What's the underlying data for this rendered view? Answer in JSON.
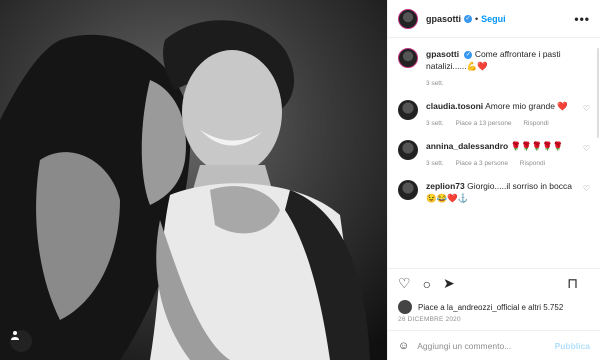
{
  "post": {
    "username": "gpasotti",
    "follow_label": "Segui",
    "dot": "•",
    "more": "•••",
    "caption": "Come affrontare i pasti natalizi......💪❤️",
    "caption_time": "3 sett.",
    "likes_text": "Piace a la_andreozzi_official e altri 5.752",
    "date": "26 DICEMBRE 2020"
  },
  "comments": [
    {
      "user": "claudia.tosoni",
      "text": "Amore mio grande ❤️",
      "time": "3 sett.",
      "likes": "Piace a 13 persone",
      "reply": "Rispondi"
    },
    {
      "user": "annina_dalessandro",
      "text": "🌹🌹🌹🌹🌹",
      "time": "3 sett.",
      "likes": "Piace a 3 persone",
      "reply": "Rispondi"
    },
    {
      "user": "zeplion73",
      "text": "Giorgio.....il sorriso in bocca😉😂❤️⚓",
      "time": "",
      "likes": "",
      "reply": ""
    }
  ],
  "add_comment": {
    "emoji": "☺",
    "placeholder": "Aggiungi un commento...",
    "publish": "Pubblica"
  },
  "icons": {
    "heart": "♡",
    "comment": "○",
    "share": "➤",
    "save": "⊓",
    "tag": "person-icon"
  }
}
